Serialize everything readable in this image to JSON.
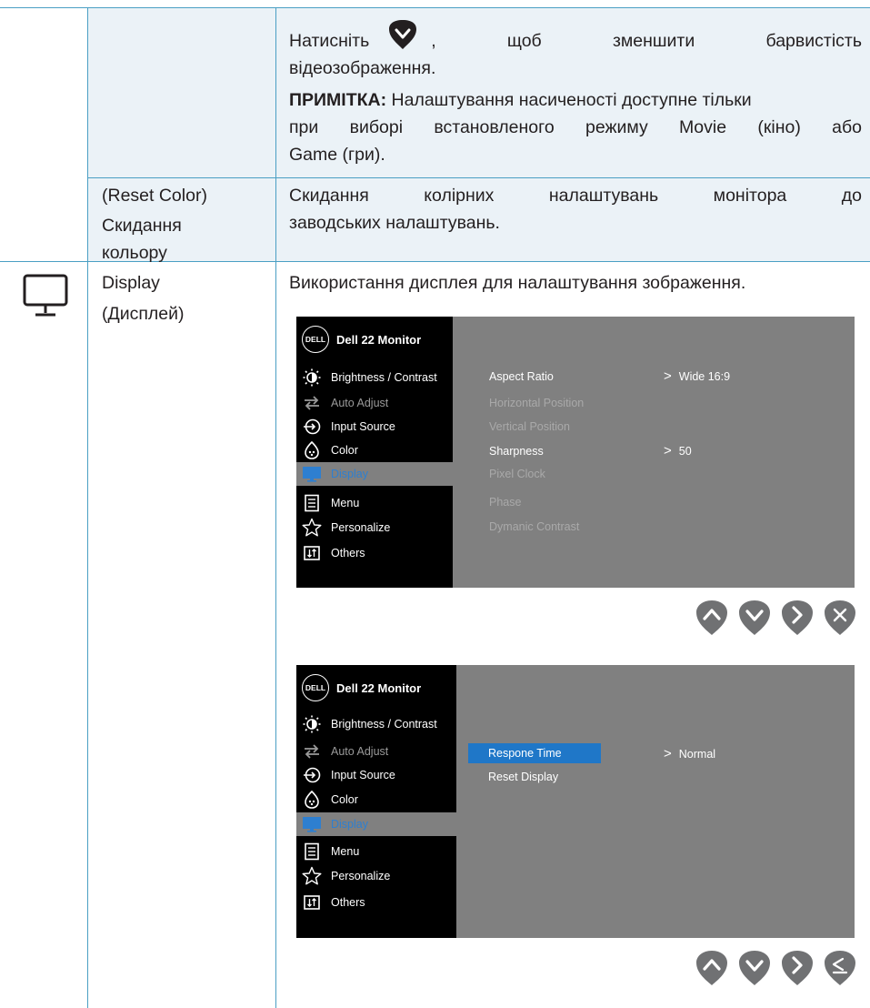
{
  "colors": {
    "rule": "#4a9fc4",
    "row_shade": "#ebf2f7",
    "button": "#707173",
    "osd_panel": "#808080",
    "osd_menu": "#000000",
    "osd_highlight": "#1f77c8",
    "osd_selected_text": "#2e7fd0"
  },
  "saturation_row": {
    "line1_part1": "Натисніть",
    "line1_comma": ",",
    "line1_part2": "щоб",
    "line1_part3": "зменшити",
    "line1_part4": "барвистість",
    "line2": "відеозображення.",
    "note_label": "ПРИМІТКА:",
    "note_line1": " Налаштування насиченості доступне тільки",
    "note_line2": "при виборі встановленого режиму Movie (кіно) або",
    "note_line3": "Game (гри).",
    "down_icon": "down-arrow-button-icon"
  },
  "reset_color_row": {
    "name_line1": "(Reset Color)",
    "name_line2": "Скидання",
    "name_line3": "кольору",
    "desc_w1": "Скидання",
    "desc_w2": "колірних",
    "desc_w3": "налаштувань",
    "desc_w4": "монітора",
    "desc_w5": "до",
    "desc_line2": "заводських налаштувань."
  },
  "display_row": {
    "icon": "monitor-icon",
    "name_line1": "Display",
    "name_line2": "(Дисплей)",
    "description": "Використання дисплея для налаштування зображення."
  },
  "osd": {
    "logo": "DELL",
    "title": "Dell 22 Monitor",
    "menu": [
      {
        "label": "Brightness / Contrast",
        "icon": "brightness-icon"
      },
      {
        "label": "Auto Adjust",
        "icon": "auto-adjust-icon"
      },
      {
        "label": "Input Source",
        "icon": "input-source-icon"
      },
      {
        "label": "Color",
        "icon": "color-icon"
      },
      {
        "label": "Display",
        "icon": "display-icon"
      },
      {
        "label": "Menu",
        "icon": "menu-icon"
      },
      {
        "label": "Personalize",
        "icon": "star-icon"
      },
      {
        "label": "Others",
        "icon": "others-icon"
      }
    ],
    "screen1": {
      "items": [
        "Aspect Ratio",
        "Horizontal Position",
        "Vertical Position",
        "Sharpness",
        "Pixel Clock",
        "Phase",
        "Dymanic Contrast"
      ],
      "values": {
        "aspect_ratio": "Wide 16:9",
        "sharpness": "50"
      },
      "buttons": [
        "up-button-icon",
        "down-button-icon",
        "right-button-icon",
        "close-button-icon"
      ]
    },
    "screen2": {
      "items": [
        "Respone Time",
        "Reset Display"
      ],
      "values": {
        "response_time": "Normal"
      },
      "buttons": [
        "up-button-icon",
        "down-button-icon",
        "right-button-icon",
        "back-button-icon"
      ]
    }
  }
}
